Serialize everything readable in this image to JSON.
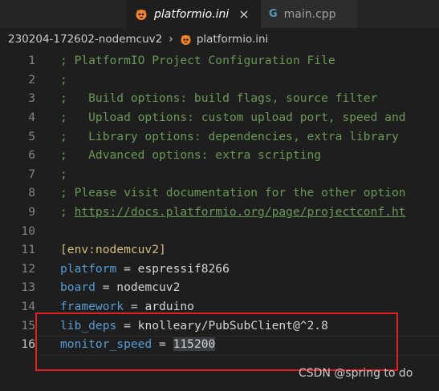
{
  "tabs": [
    {
      "label": "platformio.ini",
      "active": true,
      "icon": "platformio-icon",
      "close": "×"
    },
    {
      "label": "main.cpp",
      "active": false,
      "icon": "cpp-icon",
      "icon_glyph": "G"
    }
  ],
  "breadcrumb": {
    "folder": "230204-172602-nodemcuv2",
    "separator": "›",
    "file": "platformio.ini"
  },
  "lines": [
    {
      "n": "1",
      "text": "; PlatformIO Project Configuration File"
    },
    {
      "n": "2",
      "text": ";"
    },
    {
      "n": "3",
      "text": ";   Build options: build flags, source filter"
    },
    {
      "n": "4",
      "text": ";   Upload options: custom upload port, speed and"
    },
    {
      "n": "5",
      "text": ";   Library options: dependencies, extra library"
    },
    {
      "n": "6",
      "text": ";   Advanced options: extra scripting"
    },
    {
      "n": "7",
      "text": ";"
    },
    {
      "n": "8",
      "text": "; Please visit documentation for the other option"
    },
    {
      "n": "9",
      "prefix": "; ",
      "link": "https://docs.platformio.org/page/projectconf.ht"
    },
    {
      "n": "10",
      "text": ""
    },
    {
      "n": "11",
      "section": "[env:nodemcuv2]"
    },
    {
      "n": "12",
      "key": "platform",
      "op": " = ",
      "value": "espressif8266"
    },
    {
      "n": "13",
      "key": "board",
      "op": " = ",
      "value": "nodemcuv2"
    },
    {
      "n": "14",
      "key": "framework",
      "op": " = ",
      "value": "arduino"
    },
    {
      "n": "15",
      "key": "lib_deps",
      "op": " = ",
      "value": "knolleary/PubSubClient@^2.8"
    },
    {
      "n": "16",
      "key": "monitor_speed",
      "op": " = ",
      "value": "115200"
    }
  ],
  "watermark": "CSDN @spring to do",
  "colors": {
    "background": "#1e1e1e",
    "comment": "#6a9955",
    "key": "#569cd6",
    "section": "#d7ba7d",
    "highlight_box": "#e02020"
  }
}
